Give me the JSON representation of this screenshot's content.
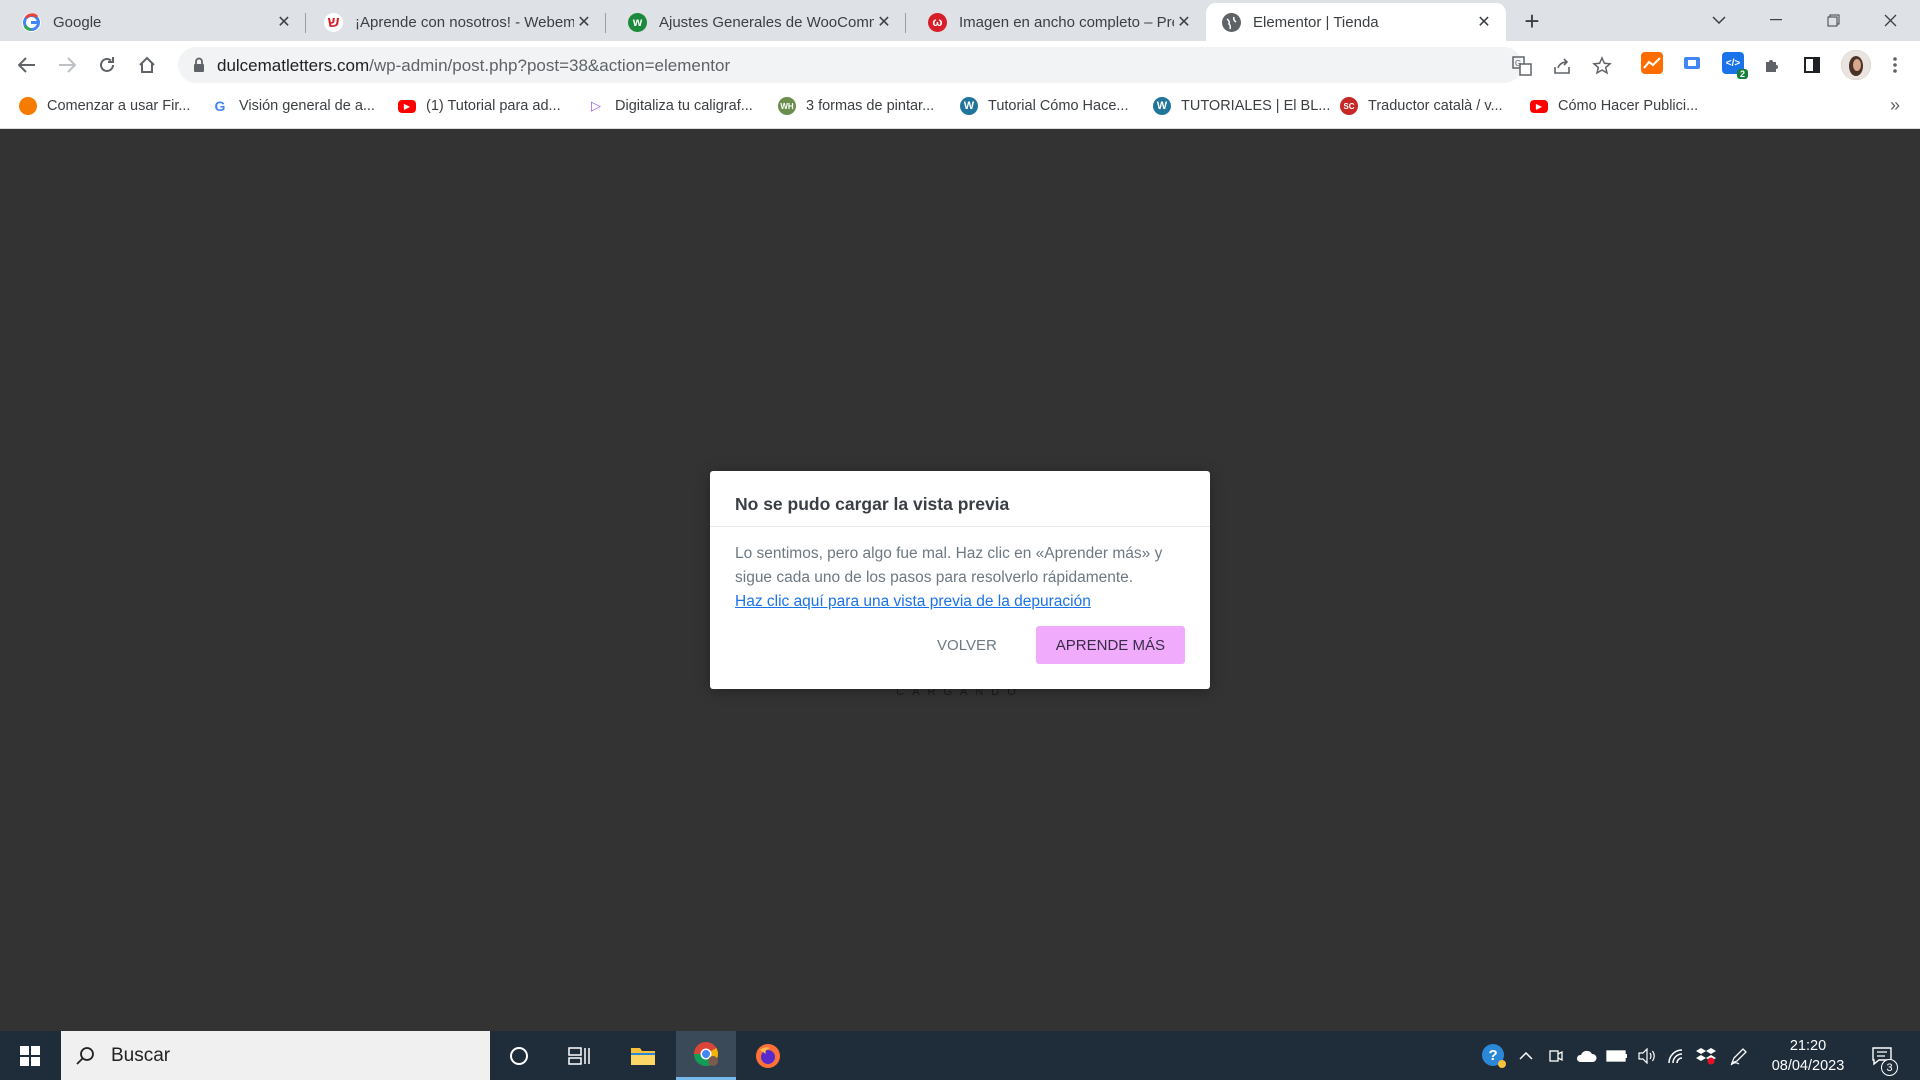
{
  "tabs": [
    {
      "title": "Google",
      "favicon": "google-icon"
    },
    {
      "title": "¡Aprende con nosotros! - Webem",
      "favicon": "webempresa-icon"
    },
    {
      "title": "Ajustes Generales de WooComm",
      "favicon": "woocommerce-icon"
    },
    {
      "title": "Imagen en ancho completo – Pre",
      "favicon": "webempresa-icon"
    },
    {
      "title": "Elementor | Tienda",
      "favicon": "globe-icon"
    }
  ],
  "address_bar": {
    "domain": "dulcematletters.com",
    "path": "/wp-admin/post.php?post=38&action=elementor"
  },
  "extensions": {
    "badge": "2"
  },
  "bookmarks": [
    "Comenzar a usar Fir...",
    "Visión general de a...",
    "(1) Tutorial para ad...",
    "Digitaliza tu caligraf...",
    "3 formas de pintar...",
    "Tutorial Cómo Hace...",
    "TUTORIALES | El BL...",
    "Traductor català / v...",
    "Cómo Hacer Publici..."
  ],
  "editor": {
    "loading_text": "CARGANDO"
  },
  "dialog": {
    "title": "No se pudo cargar la vista previa",
    "message": "Lo sentimos, pero algo fue mal. Haz clic en «Aprender más» y sigue cada uno de los pasos para resolverlo rápidamente.",
    "debug_link": "Haz clic aquí para una vista previa de la depuración",
    "back_label": "VOLVER",
    "learn_label": "APRENDE MÁS"
  },
  "taskbar": {
    "search_placeholder": "Buscar",
    "time": "21:20",
    "date": "08/04/2023",
    "notification_count": "3"
  },
  "colors": {
    "accent": "#f0abfc",
    "editor_bg": "#333333",
    "taskbar_bg": "#1f2d3b"
  }
}
